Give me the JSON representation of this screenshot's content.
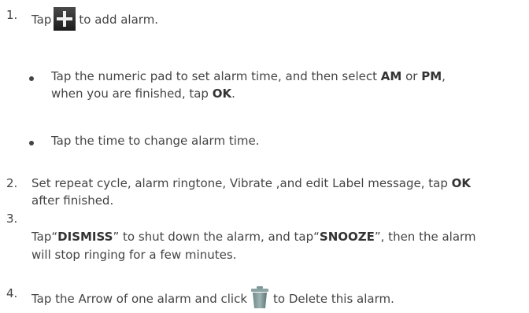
{
  "steps": [
    {
      "num": "1.",
      "pre": "Tap",
      "icon": "add-icon",
      "post": "to add alarm."
    },
    {
      "num": "2.",
      "line1_pre": "Set repeat cycle, alarm ringtone, Vibrate ,and edit Label message, tap",
      "line1_bold": "OK",
      "line2": "after finished."
    },
    {
      "num": "3.",
      "line1_a": "Tap“",
      "line1_b1": "DISMISS",
      "line1_c": "” to shut down the alarm, and tap“",
      "line1_b2": "SNOOZE",
      "line1_d": "”, then the alarm",
      "line2": "will stop ringing for a few minutes."
    },
    {
      "num": "4.",
      "pre": "Tap the Arrow of one alarm and click",
      "icon": "trash-icon",
      "post": "to Delete this alarm."
    }
  ],
  "bullets": [
    {
      "line1_a": "Tap the numeric pad to set alarm time, and then select",
      "bold1": "AM",
      "line1_b": "or",
      "bold2": "PM",
      "line1_c": ",",
      "line2_a": "when you are finished, tap",
      "bold3": "OK",
      "line2_b": "."
    },
    {
      "text": "Tap the time to change alarm time."
    }
  ]
}
